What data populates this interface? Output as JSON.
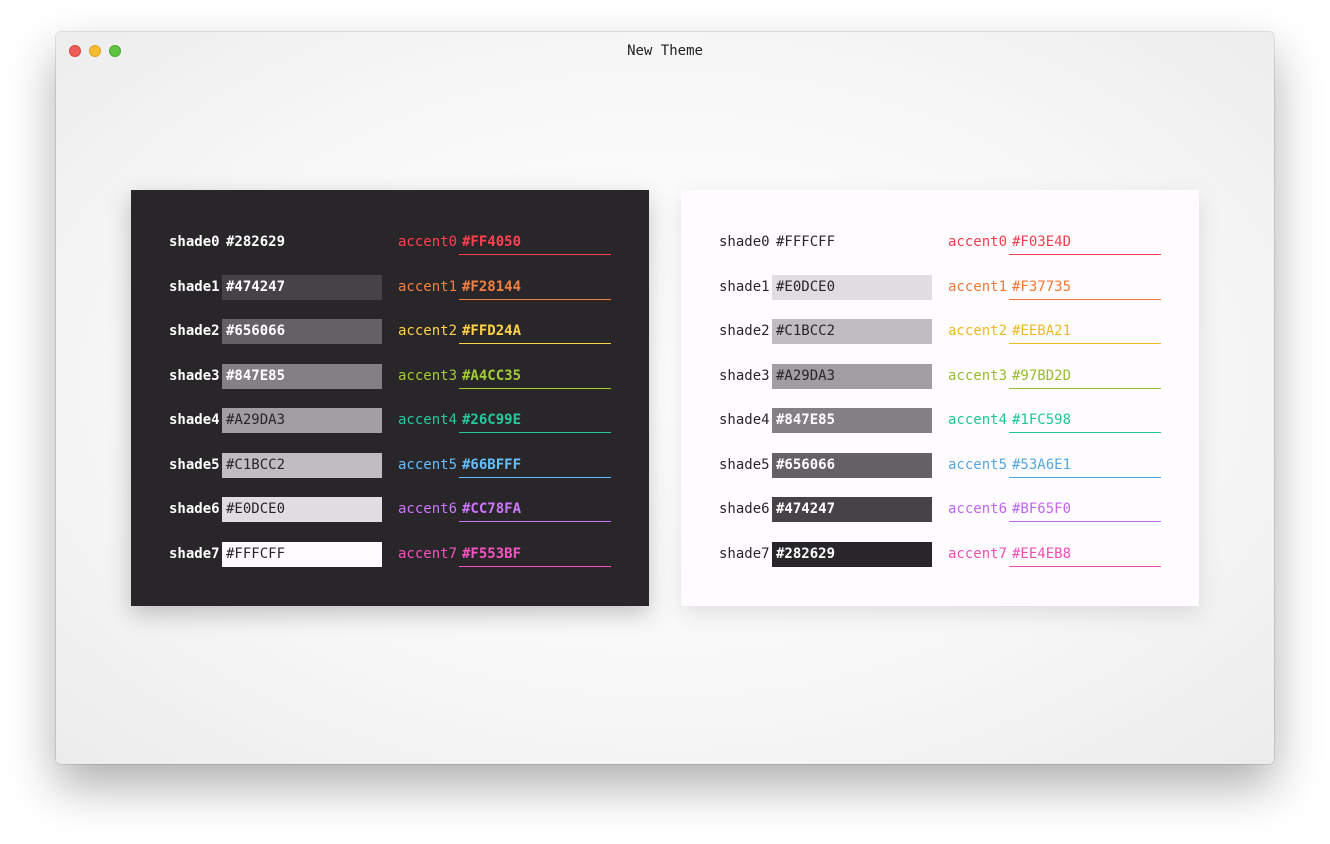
{
  "window": {
    "title": "New Theme"
  },
  "dark": {
    "shades": [
      {
        "label": "shade0",
        "value": "#282629",
        "bg": "#282629",
        "fg": "#ffffff",
        "bold": true
      },
      {
        "label": "shade1",
        "value": "#474247",
        "bg": "#474247",
        "fg": "#ffffff",
        "bold": true
      },
      {
        "label": "shade2",
        "value": "#656066",
        "bg": "#656066",
        "fg": "#ffffff",
        "bold": true
      },
      {
        "label": "shade3",
        "value": "#847E85",
        "bg": "#847E85",
        "fg": "#ffffff",
        "bold": true
      },
      {
        "label": "shade4",
        "value": "#A29DA3",
        "bg": "#A29DA3",
        "fg": "#282629",
        "bold": false
      },
      {
        "label": "shade5",
        "value": "#C1BCC2",
        "bg": "#C1BCC2",
        "fg": "#282629",
        "bold": false
      },
      {
        "label": "shade6",
        "value": "#E0DCE0",
        "bg": "#E0DCE0",
        "fg": "#282629",
        "bold": false
      },
      {
        "label": "shade7",
        "value": "#FFFCFF",
        "bg": "#FFFCFF",
        "fg": "#282629",
        "bold": false
      }
    ],
    "accents": [
      {
        "label": "accent0",
        "value": "#FF4050",
        "color": "#FF4050"
      },
      {
        "label": "accent1",
        "value": "#F28144",
        "color": "#F28144"
      },
      {
        "label": "accent2",
        "value": "#FFD24A",
        "color": "#FFD24A"
      },
      {
        "label": "accent3",
        "value": "#A4CC35",
        "color": "#A4CC35"
      },
      {
        "label": "accent4",
        "value": "#26C99E",
        "color": "#26C99E"
      },
      {
        "label": "accent5",
        "value": "#66BFFF",
        "color": "#66BFFF"
      },
      {
        "label": "accent6",
        "value": "#CC78FA",
        "color": "#CC78FA"
      },
      {
        "label": "accent7",
        "value": "#F553BF",
        "color": "#F553BF"
      }
    ]
  },
  "light": {
    "shades": [
      {
        "label": "shade0",
        "value": "#FFFCFF",
        "bg": "#FFFCFF",
        "fg": "#282629",
        "bold": false
      },
      {
        "label": "shade1",
        "value": "#E0DCE0",
        "bg": "#E0DCE0",
        "fg": "#282629",
        "bold": false
      },
      {
        "label": "shade2",
        "value": "#C1BCC2",
        "bg": "#C1BCC2",
        "fg": "#282629",
        "bold": false
      },
      {
        "label": "shade3",
        "value": "#A29DA3",
        "bg": "#A29DA3",
        "fg": "#282629",
        "bold": false
      },
      {
        "label": "shade4",
        "value": "#847E85",
        "bg": "#847E85",
        "fg": "#ffffff",
        "bold": true
      },
      {
        "label": "shade5",
        "value": "#656066",
        "bg": "#656066",
        "fg": "#ffffff",
        "bold": true
      },
      {
        "label": "shade6",
        "value": "#474247",
        "bg": "#474247",
        "fg": "#ffffff",
        "bold": true
      },
      {
        "label": "shade7",
        "value": "#282629",
        "bg": "#282629",
        "fg": "#ffffff",
        "bold": true
      }
    ],
    "accents": [
      {
        "label": "accent0",
        "value": "#F03E4D",
        "color": "#F03E4D"
      },
      {
        "label": "accent1",
        "value": "#F37735",
        "color": "#F37735"
      },
      {
        "label": "accent2",
        "value": "#EEBA21",
        "color": "#EEBA21"
      },
      {
        "label": "accent3",
        "value": "#97BD2D",
        "color": "#97BD2D"
      },
      {
        "label": "accent4",
        "value": "#1FC598",
        "color": "#1FC598"
      },
      {
        "label": "accent5",
        "value": "#53A6E1",
        "color": "#53A6E1"
      },
      {
        "label": "accent6",
        "value": "#BF65F0",
        "color": "#BF65F0"
      },
      {
        "label": "accent7",
        "value": "#EE4EB8",
        "color": "#EE4EB8"
      }
    ]
  }
}
